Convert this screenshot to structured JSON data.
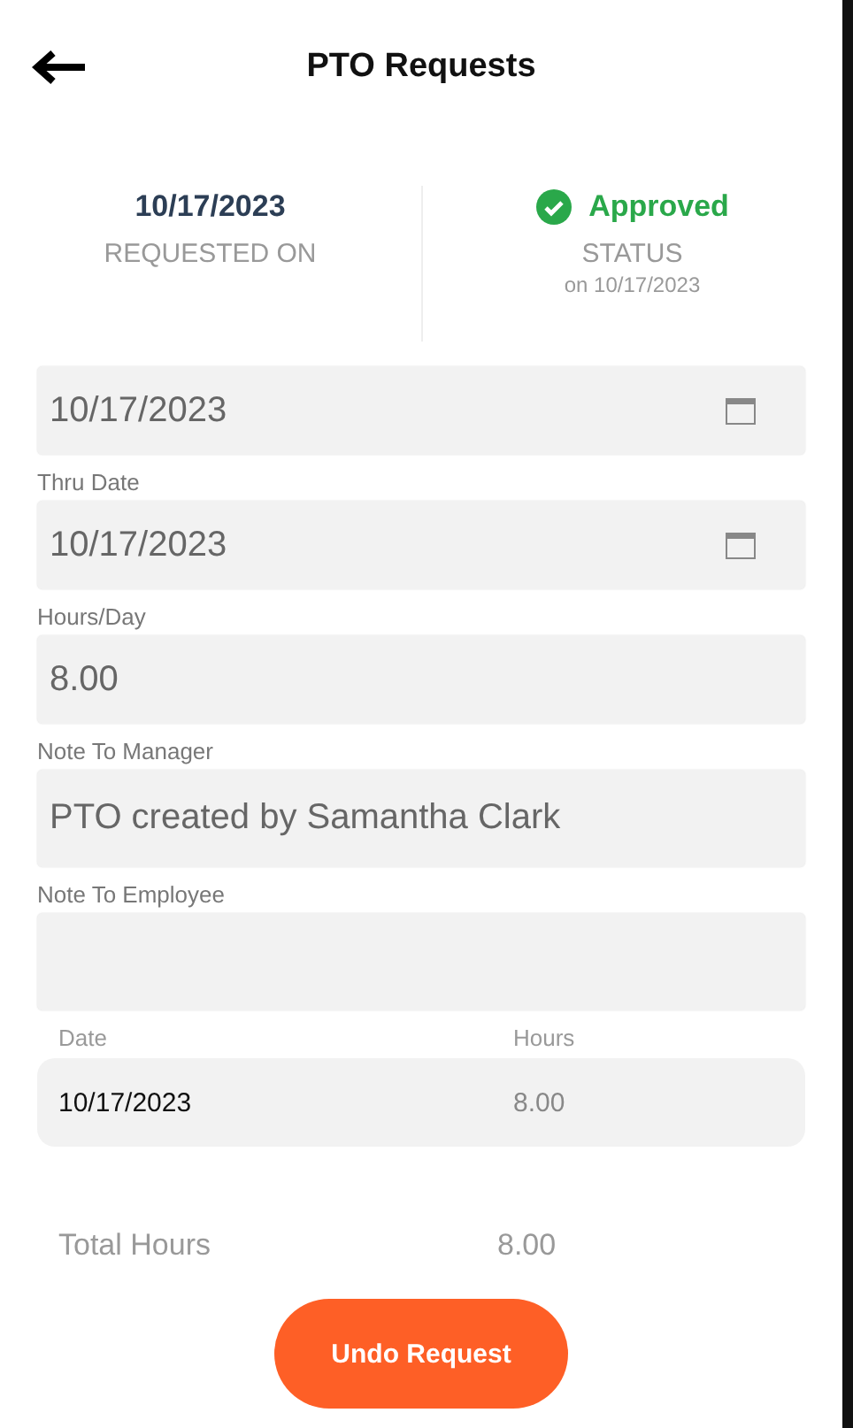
{
  "header": {
    "title": "PTO Requests"
  },
  "summary": {
    "requested_on": {
      "value": "10/17/2023",
      "label": "REQUESTED ON"
    },
    "status": {
      "value": "Approved",
      "label": "STATUS",
      "date": "on 10/17/2023"
    }
  },
  "fields": [
    {
      "kind": "date",
      "value": "10/17/2023"
    },
    {
      "kind": "date",
      "label": "Thru Date",
      "value": "10/17/2023"
    },
    {
      "kind": "text",
      "label": "Hours/Day",
      "value": "8.00"
    },
    {
      "kind": "note",
      "label": "Note To Manager",
      "value": "PTO created by Samantha Clark"
    },
    {
      "kind": "note",
      "label": "Note To Employee"
    }
  ],
  "table": {
    "columns": [
      "Date",
      "Hours"
    ],
    "rows": [
      [
        "10/17/2023",
        "8.00"
      ]
    ]
  },
  "total": {
    "label": "Total Hours",
    "value": "8.00"
  },
  "button": "Undo Request"
}
